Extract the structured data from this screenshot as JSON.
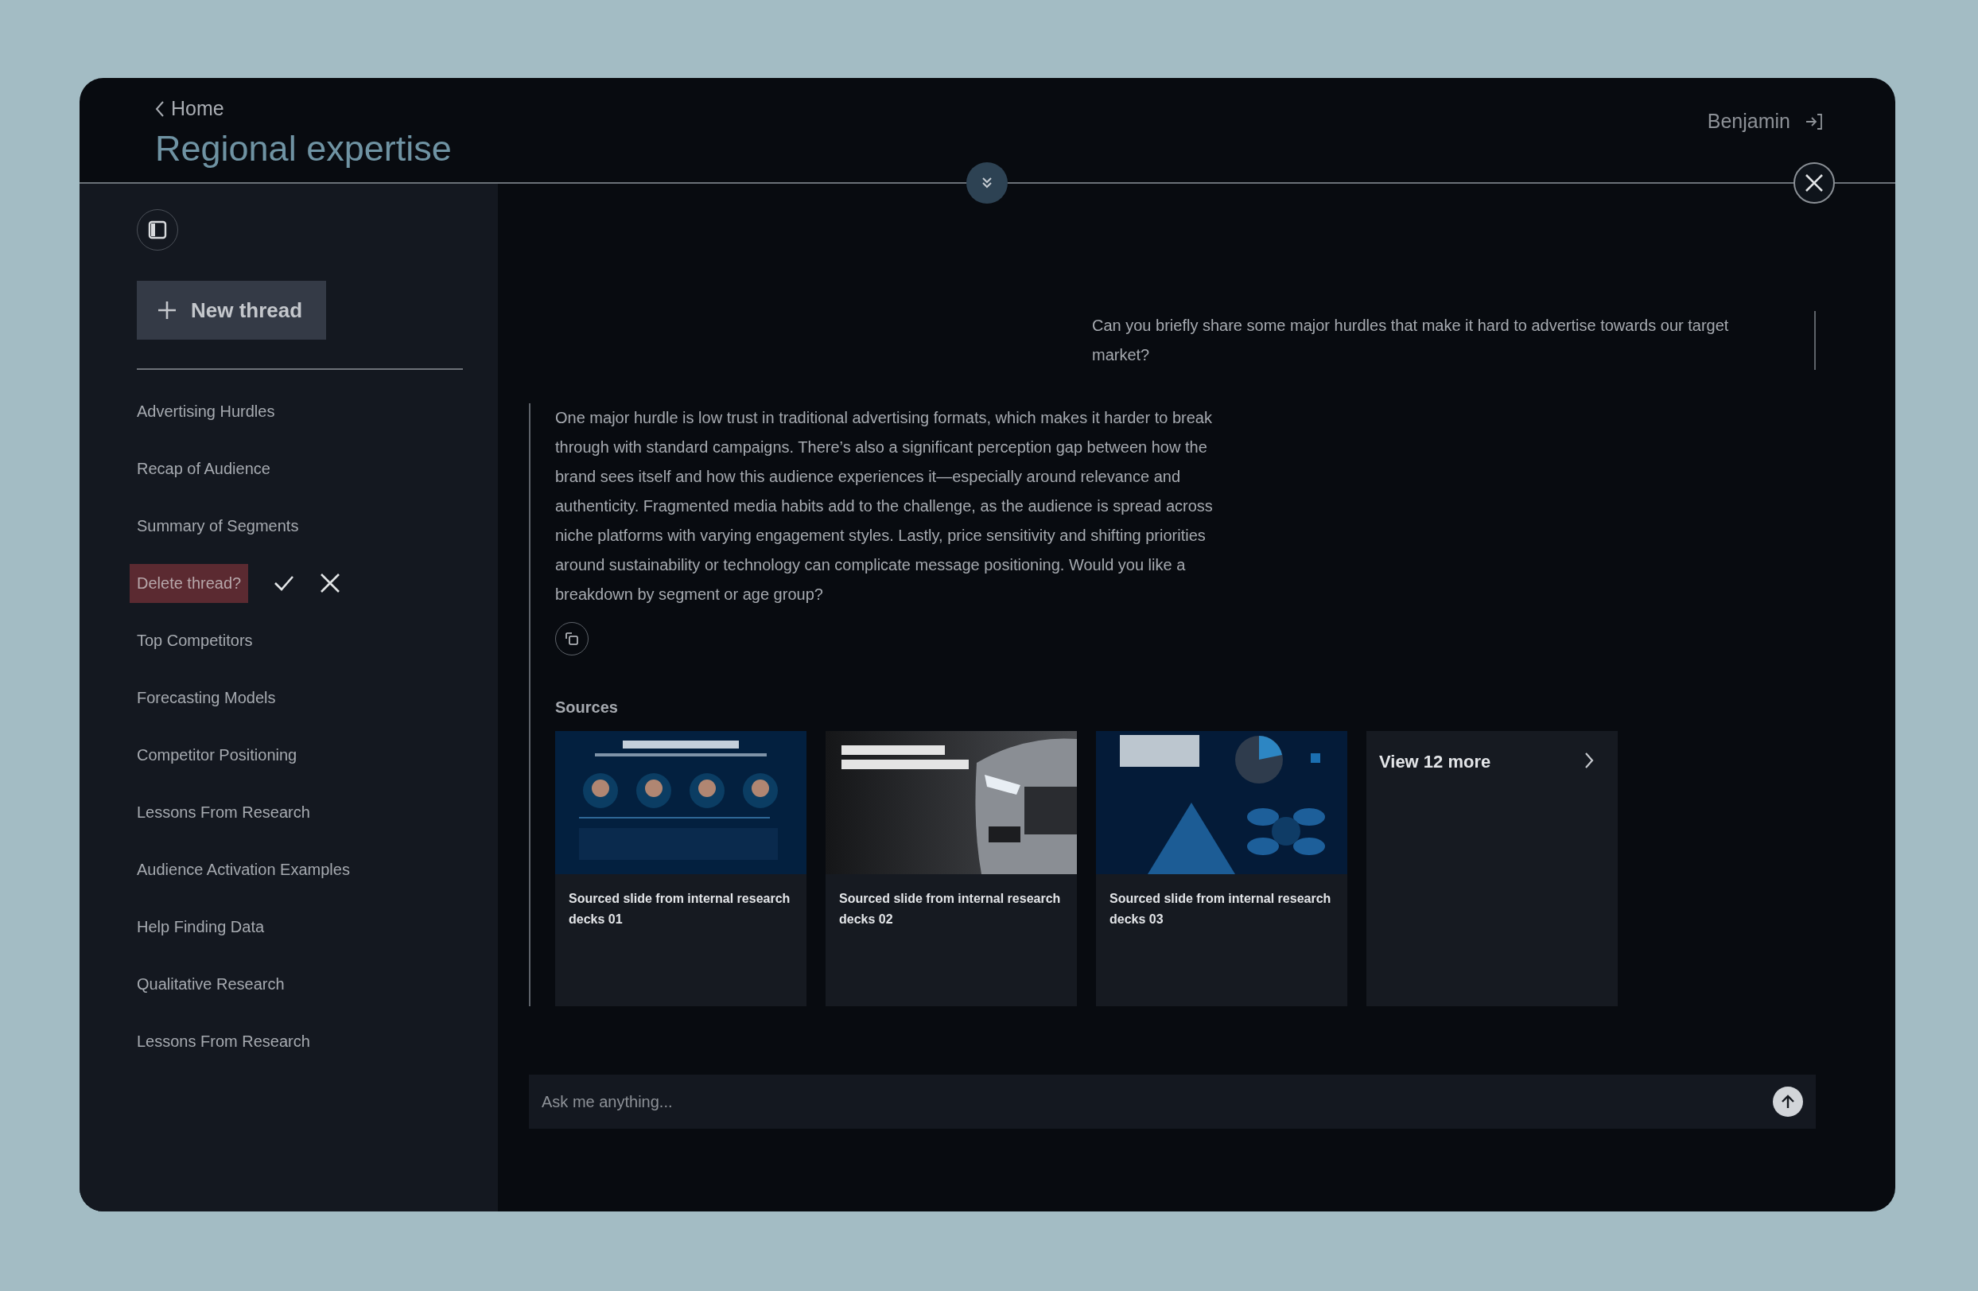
{
  "header": {
    "back_link": "Home",
    "title": "Regional expertise",
    "user": "Benjamin"
  },
  "sidebar": {
    "new_thread": "New thread",
    "threads": [
      {
        "kind": "thread",
        "label": "Advertising Hurdles"
      },
      {
        "kind": "thread",
        "label": "Recap of Audience"
      },
      {
        "kind": "thread",
        "label": "Summary of Segments"
      },
      {
        "kind": "delete_confirm",
        "label": "Delete thread?"
      },
      {
        "kind": "thread",
        "label": "Top Competitors"
      },
      {
        "kind": "thread",
        "label": "Forecasting Models"
      },
      {
        "kind": "thread",
        "label": "Competitor Positioning"
      },
      {
        "kind": "thread",
        "label": "Lessons From Research"
      },
      {
        "kind": "thread",
        "label": "Audience Activation Examples"
      },
      {
        "kind": "thread",
        "label": "Help Finding Data"
      },
      {
        "kind": "thread",
        "label": "Qualitative Research"
      },
      {
        "kind": "thread",
        "label": "Lessons From Research"
      }
    ]
  },
  "conversation": {
    "question": "Can you briefly share some major hurdles that make it hard to advertise towards our target market?",
    "answer": "One major hurdle is low trust in traditional advertising formats, which makes it harder to break through with standard campaigns. There’s also a significant perception gap between how the brand sees itself and how this audience experiences it—especially around relevance and authenticity. Fragmented media habits add to the challenge, as the audience is spread across niche platforms with varying engagement styles. Lastly, price sensitivity and shifting priorities around sustainability or technology can complicate message positioning. Would you like a breakdown by segment or age group?",
    "sources_heading": "Sources",
    "sources": [
      {
        "kind": "picture",
        "caption": "Sourced slide from internal research decks 01"
      },
      {
        "kind": "picture",
        "caption": "Sourced slide from internal research decks 02"
      },
      {
        "kind": "picture",
        "caption": "Sourced slide from internal research decks 03"
      }
    ],
    "more_link": "View 12 more"
  },
  "composer": {
    "placeholder": "Ask me anything..."
  }
}
